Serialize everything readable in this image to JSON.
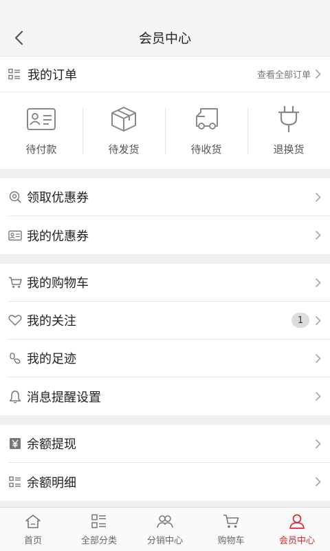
{
  "header": {
    "title": "会员中心"
  },
  "orders": {
    "title": "我的订单",
    "view_all": "查看全部订单",
    "statuses": [
      {
        "label": "待付款",
        "icon": "wallet-card-icon"
      },
      {
        "label": "待发货",
        "icon": "package-box-icon"
      },
      {
        "label": "待收货",
        "icon": "delivery-truck-icon"
      },
      {
        "label": "退换货",
        "icon": "plug-icon"
      }
    ]
  },
  "coupons": {
    "items": [
      {
        "label": "领取优惠券",
        "icon": "coupon-search-icon"
      },
      {
        "label": "我的优惠券",
        "icon": "coupon-card-icon"
      }
    ]
  },
  "shopping": {
    "items": [
      {
        "label": "我的购物车",
        "icon": "cart-icon"
      },
      {
        "label": "我的关注",
        "icon": "heart-icon",
        "badge": "1"
      },
      {
        "label": "我的足迹",
        "icon": "footprint-icon"
      },
      {
        "label": "消息提醒设置",
        "icon": "bell-icon"
      }
    ]
  },
  "balance": {
    "items": [
      {
        "label": "余额提现",
        "icon": "yen-icon"
      },
      {
        "label": "余额明细",
        "icon": "list-icon"
      }
    ]
  },
  "tabbar": {
    "items": [
      {
        "label": "首页",
        "icon": "home-icon"
      },
      {
        "label": "全部分类",
        "icon": "category-list-icon"
      },
      {
        "label": "分销中心",
        "icon": "distribution-users-icon"
      },
      {
        "label": "购物车",
        "icon": "cart-icon"
      },
      {
        "label": "会员中心",
        "icon": "user-icon",
        "active": true
      }
    ]
  },
  "colors": {
    "accent": "#e0282e",
    "icon_gray": "#777777"
  }
}
